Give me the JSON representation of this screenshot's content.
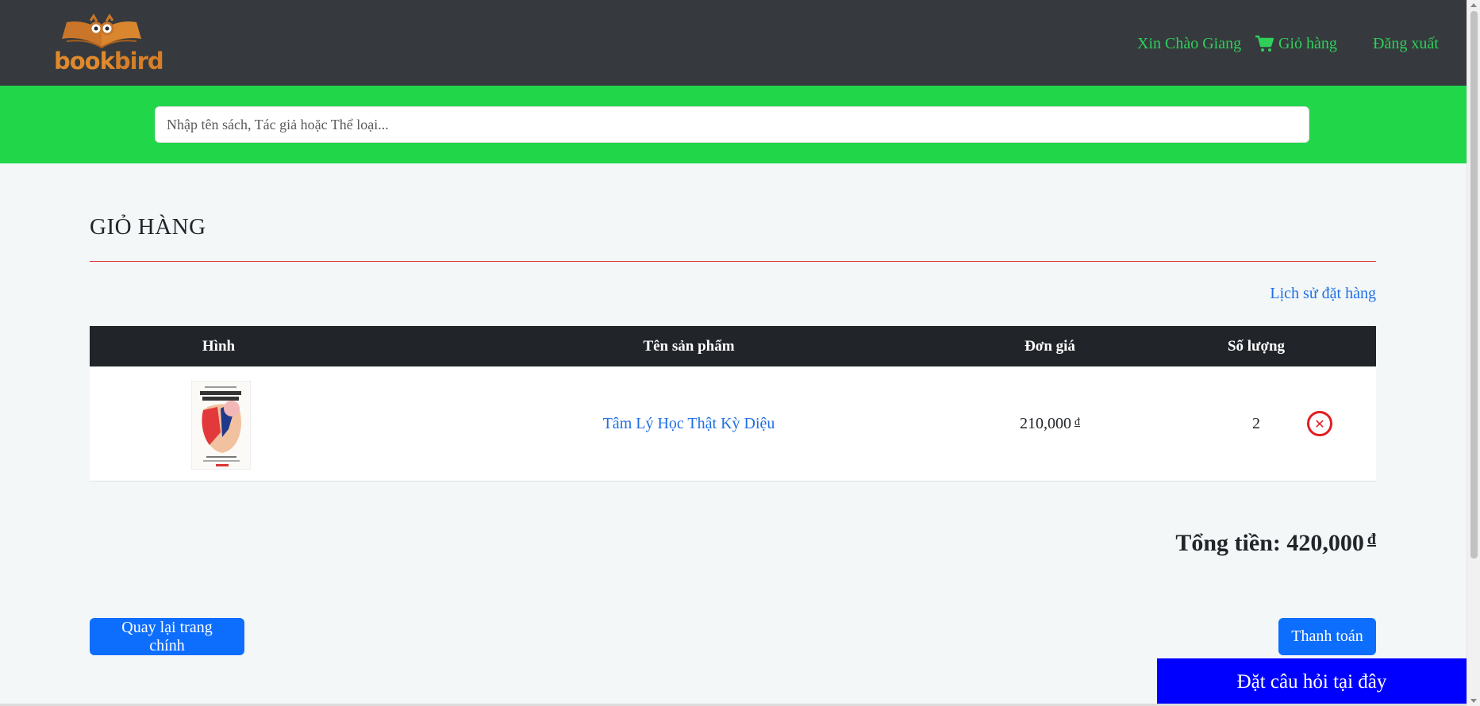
{
  "header": {
    "logo": {
      "text_a": "book",
      "text_b": "bird"
    },
    "greeting": "Xin Chào Giang",
    "cart_label": "Giỏ hàng",
    "logout_label": "Đăng xuất",
    "colors": {
      "bar": "#363a3e",
      "nav_text": "#2fd05a"
    }
  },
  "search": {
    "placeholder": "Nhập tên sách, Tác giả hoặc Thể loại...",
    "value": "",
    "band_color": "#22d64a"
  },
  "page": {
    "title": "GIỎ HÀNG",
    "history_link": "Lịch sử đặt hàng"
  },
  "table": {
    "headers": [
      "Hình",
      "Tên sản phẩm",
      "Đơn giá",
      "Số lượng"
    ],
    "rows": [
      {
        "image_icon": "book-cover",
        "name": "Tâm Lý Học Thật Kỳ Diệu",
        "price": "210,000",
        "currency": "đ",
        "quantity": "2"
      }
    ]
  },
  "total": {
    "label": "Tổng tiền: 420,000",
    "currency": "đ"
  },
  "buttons": {
    "back": "Quay lại trang chính",
    "pay": "Thanh toán",
    "ask": "Đặt câu hỏi tại đây"
  }
}
